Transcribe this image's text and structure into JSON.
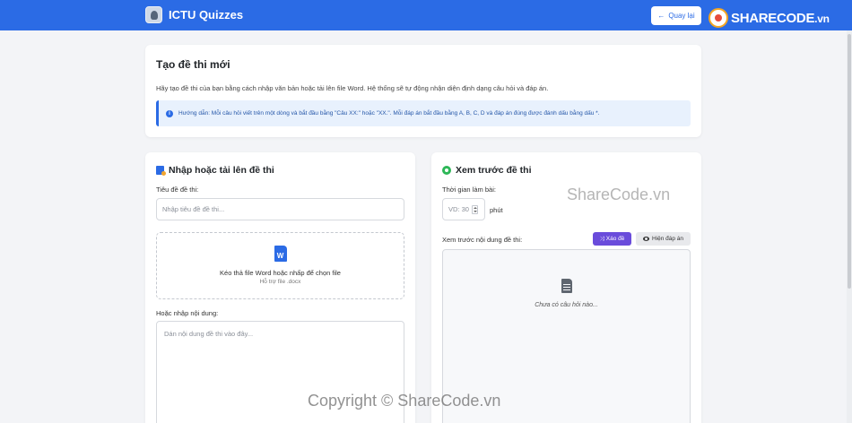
{
  "navbar": {
    "app_name": "ICTU Quizzes",
    "back_label": "Quay lại",
    "watermark_logo": "SHARECODE",
    "watermark_logo_suffix": ".vn"
  },
  "intro": {
    "title": "Tạo đề thi mới",
    "description": "Hãy tạo đề thi của bạn bằng cách nhập văn bản hoặc tải lên file Word. Hệ thống sẽ tự động nhận diện định dạng câu hỏi và đáp án.",
    "alert": "Hướng dẫn: Mỗi câu hỏi viết trên một dòng và bắt đầu bằng \"Câu XX:\" hoặc \"XX.\". Mỗi đáp án bắt đầu bằng A, B, C, D và đáp án đúng được đánh dấu bằng dấu *."
  },
  "upload_panel": {
    "title": "Nhập hoặc tải lên đề thi",
    "title_label": "Tiêu đề đề thi:",
    "title_placeholder": "Nhập tiêu đề đề thi...",
    "dropzone_main": "Kéo thả file Word hoặc nhấp để chọn file",
    "dropzone_sub": "Hỗ trợ file .docx",
    "content_label": "Hoặc nhập nội dung:",
    "content_placeholder": "Dán nội dung đề thi vào đây..."
  },
  "preview_panel": {
    "title": "Xem trước đề thi",
    "time_label": "Thời gian làm bài:",
    "time_placeholder": "VD: 30",
    "time_unit": "phút",
    "content_label": "Xem trước nội dung đề thi:",
    "shuffle_label": "Xáo đề",
    "show_answer_label": "Hiện đáp án",
    "empty_text": "Chưa có câu hỏi nào..."
  },
  "watermarks": {
    "middle": "ShareCode.vn",
    "bottom": "Copyright © ShareCode.vn"
  },
  "icons": [
    "app-logo-icon",
    "arrow-left-icon",
    "info-icon",
    "word-file-icon",
    "eye-icon",
    "shuffle-icon",
    "document-icon"
  ],
  "colors": {
    "primary": "#2b6be5",
    "success": "#2db757",
    "shuffle": "#6a4cdb",
    "background": "#f3f4f7"
  }
}
